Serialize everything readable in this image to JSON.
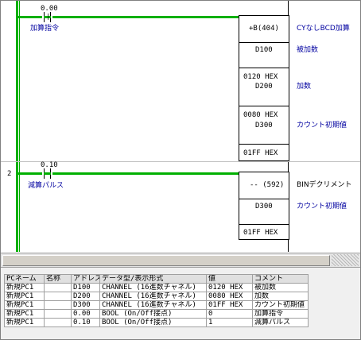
{
  "ladder": {
    "rung1": {
      "contact_address": "0.00",
      "contact_comment": "加算指令",
      "instruction": "+B(404)",
      "instruction_comment": "CYなしBCD加算",
      "operands": [
        {
          "value": "",
          "address": "D100",
          "comment": "被加数"
        },
        {
          "value": "0120 HEX",
          "address": "D200",
          "comment": "加数"
        },
        {
          "value": "0080 HEX",
          "address": "D300",
          "comment": "カウント初期値"
        },
        {
          "value": "01FF HEX",
          "address": "",
          "comment": ""
        }
      ]
    },
    "rung2": {
      "number": "2",
      "contact_address": "0.10",
      "contact_comment": "減算パルス",
      "instruction": "-- (592)",
      "instruction_comment": "BINデクリメント",
      "operands": [
        {
          "value": "",
          "address": "D300",
          "comment": "カウント初期値"
        },
        {
          "value": "01FF HEX",
          "address": "",
          "comment": ""
        }
      ]
    }
  },
  "watch_table": {
    "headers": [
      "PCネーム",
      "名称",
      "アドレス",
      "データ型/表示形式",
      "値",
      "コメント"
    ],
    "rows": [
      [
        "新規PC1",
        "",
        "D100",
        "CHANNEL (16進数チャネル)",
        "0120 HEX",
        "被加数"
      ],
      [
        "新規PC1",
        "",
        "D200",
        "CHANNEL (16進数チャネル)",
        "0080 HEX",
        "加数"
      ],
      [
        "新規PC1",
        "",
        "D300",
        "CHANNEL (16進数チャネル)",
        "01FF HEX",
        "カウント初期値"
      ],
      [
        "新規PC1",
        "",
        "0.00",
        "BOOL (On/Off接点)",
        "0",
        "加算指令"
      ],
      [
        "新規PC1",
        "",
        "0.10",
        "BOOL (On/Off接点)",
        "1",
        "減算パルス"
      ]
    ]
  },
  "colors": {
    "power_flow": "#00b000",
    "comment_text": "#0000a0"
  }
}
